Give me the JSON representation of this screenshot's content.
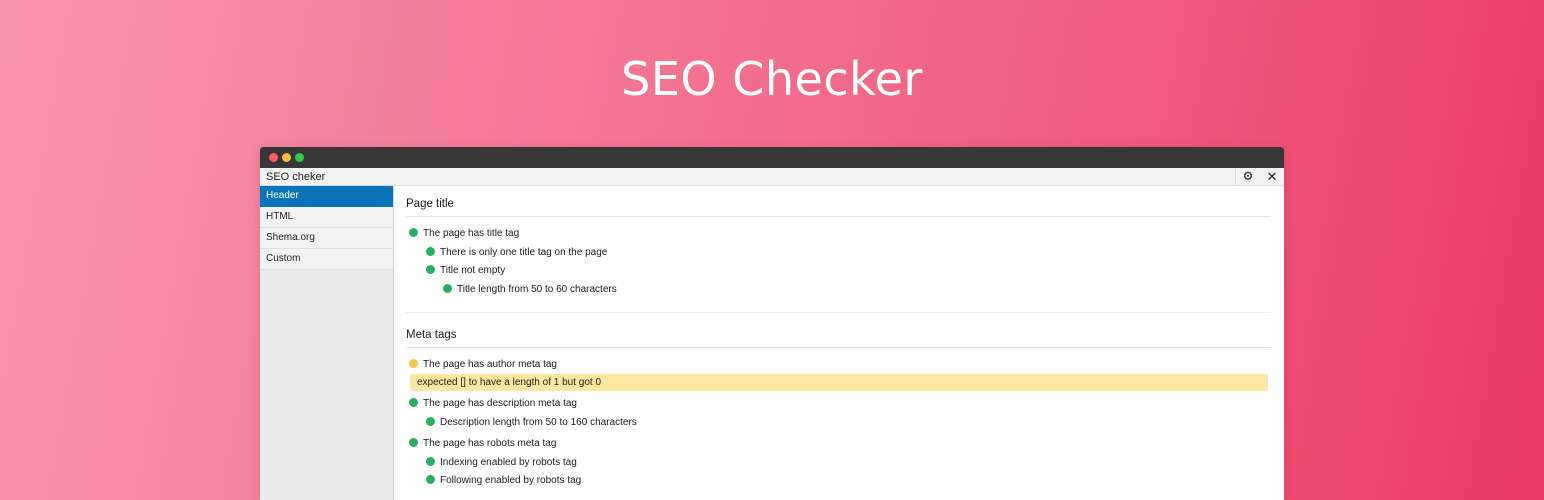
{
  "hero": {
    "title": "SEO Checker"
  },
  "panel": {
    "title": "SEO cheker"
  },
  "colors": {
    "accent": "#0a74b8",
    "pass": "#27ae60",
    "warning": "#f4c84c",
    "error_bg": "#fde6a0"
  },
  "icons": {
    "settings": "gear-icon",
    "close": "close-icon"
  },
  "sidebar": {
    "items": [
      {
        "label": "Header",
        "active": true
      },
      {
        "label": "HTML",
        "active": false
      },
      {
        "label": "Shema.org",
        "active": false
      },
      {
        "label": "Custom",
        "active": false
      }
    ]
  },
  "sections": [
    {
      "title": "Page title",
      "checks": [
        {
          "label": "The page has title tag",
          "status": "pass",
          "level": 0
        },
        {
          "label": "There is only one title tag on the page",
          "status": "pass",
          "level": 1
        },
        {
          "label": "Title not empty",
          "status": "pass",
          "level": 1
        },
        {
          "label": "Title length from 50 to 60 characters",
          "status": "pass",
          "level": 2
        }
      ]
    },
    {
      "title": "Meta tags",
      "checks": [
        {
          "label": "The page has author meta tag",
          "status": "warning",
          "level": 0
        },
        {
          "label": "The page has description meta tag",
          "status": "pass",
          "level": 0
        },
        {
          "label": "Description length from 50 to 160 characters",
          "status": "pass",
          "level": 1
        },
        {
          "label": "The page has robots meta tag",
          "status": "pass",
          "level": 0
        },
        {
          "label": "Indexing enabled by robots tag",
          "status": "pass",
          "level": 1
        },
        {
          "label": "Following enabled by robots tag",
          "status": "pass",
          "level": 1
        }
      ],
      "error_message": "expected [] to have a length of 1 but got 0"
    }
  ]
}
